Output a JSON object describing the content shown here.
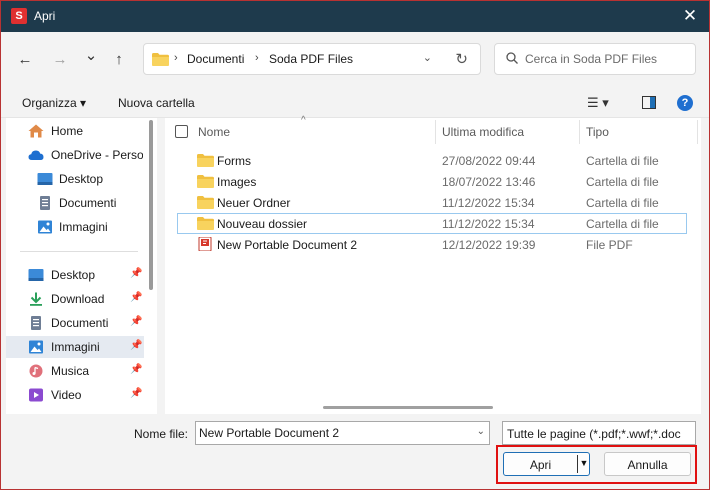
{
  "window": {
    "title": "Apri",
    "app_icon_letter": "S",
    "accent": "#1e3a4c",
    "close_glyph": "✕"
  },
  "nav": {
    "back_glyph": "←",
    "forward_glyph": "→",
    "history_glyph": "⌄",
    "up_glyph": "↑",
    "breadcrumb": [
      "Documenti",
      "Soda PDF Files"
    ],
    "separator": "›",
    "refresh_glyph": "↻",
    "search_placeholder": "Cerca in Soda PDF Files"
  },
  "toolbar": {
    "organize_label": "Organizza ▾",
    "new_folder_label": "Nuova cartella",
    "view_glyph": "☰ ▾",
    "help_glyph": "?"
  },
  "sidebar": {
    "items": [
      {
        "label": "Home",
        "icon": "home-icon"
      },
      {
        "label": "OneDrive - Personal",
        "icon": "cloud-icon"
      },
      {
        "label": "Desktop",
        "icon": "desktop-icon"
      },
      {
        "label": "Documenti",
        "icon": "documents-icon"
      },
      {
        "label": "Immagini",
        "icon": "pictures-icon"
      }
    ],
    "quick_access": [
      {
        "label": "Desktop",
        "icon": "desktop-icon"
      },
      {
        "label": "Download",
        "icon": "download-icon"
      },
      {
        "label": "Documenti",
        "icon": "documents-icon"
      },
      {
        "label": "Immagini",
        "icon": "pictures-icon"
      },
      {
        "label": "Musica",
        "icon": "music-icon"
      },
      {
        "label": "Video",
        "icon": "video-icon"
      }
    ],
    "pin_glyph": "📌"
  },
  "files": {
    "columns": [
      "Nome",
      "Ultima modifica",
      "Tipo"
    ],
    "sort_glyph": "^",
    "rows": [
      {
        "name": "Forms",
        "modified": "27/08/2022 09:44",
        "type": "Cartella di file",
        "icon": "folder-icon"
      },
      {
        "name": "Images",
        "modified": "18/07/2022 13:46",
        "type": "Cartella di file",
        "icon": "folder-icon"
      },
      {
        "name": "Neuer Ordner",
        "modified": "11/12/2022 15:34",
        "type": "Cartella di file",
        "icon": "folder-icon"
      },
      {
        "name": "Nouveau dossier",
        "modified": "11/12/2022 15:34",
        "type": "Cartella di file",
        "icon": "folder-icon"
      },
      {
        "name": "New Portable Document 2",
        "modified": "12/12/2022 19:39",
        "type": "File PDF",
        "icon": "pdf-icon"
      }
    ]
  },
  "footer": {
    "filename_label": "Nome file:",
    "filename_value": "New Portable Document 2",
    "filter_value": "Tutte le pagine (*.pdf;*.wwf;*.doc",
    "open_label": "Apri",
    "cancel_label": "Annulla",
    "dropdown_glyph": "▼"
  }
}
